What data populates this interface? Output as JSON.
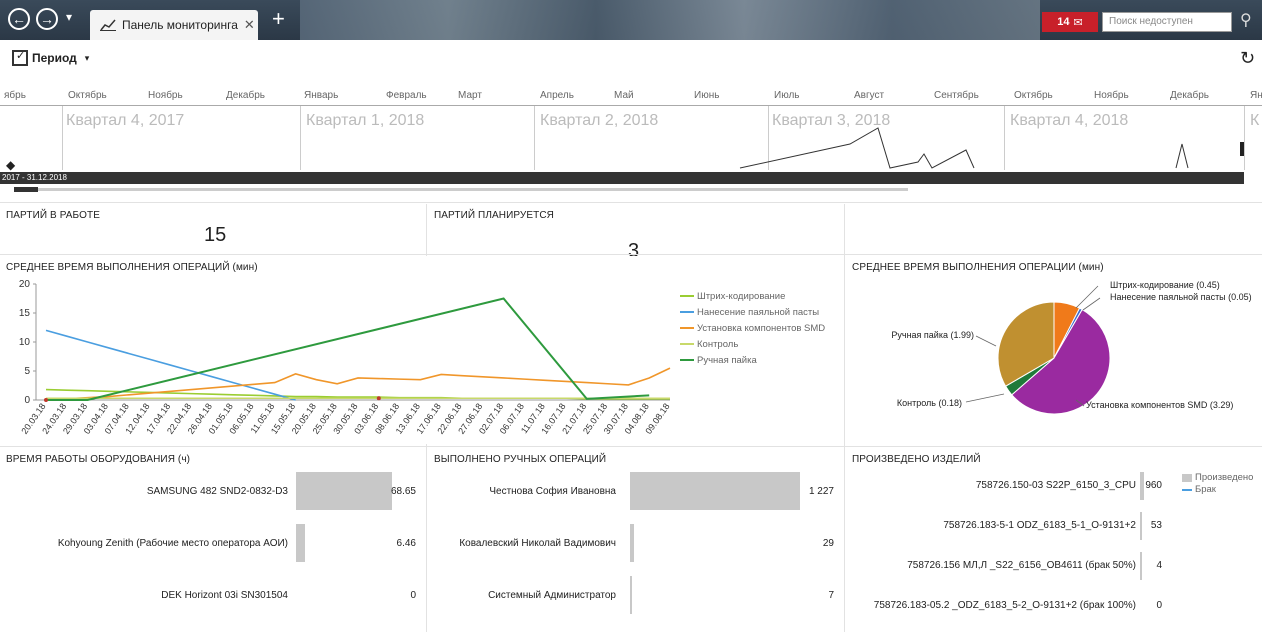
{
  "titlebar": {
    "back": "←",
    "forward": "→",
    "dropdown": "▾",
    "tab_label": "Панель мониторинга",
    "tab_close": "✕",
    "new_tab": "+",
    "notif_count": "14",
    "search_placeholder": "Поиск недоступен"
  },
  "toolbar": {
    "period_label": "Период"
  },
  "timeline": {
    "months": [
      "ябрь",
      "Октябрь",
      "Ноябрь",
      "Декабрь",
      "Январь",
      "Февраль",
      "Март",
      "Апрель",
      "Май",
      "Июнь",
      "Июль",
      "Август",
      "Сентябрь",
      "Октябрь",
      "Ноябрь",
      "Декабрь",
      "Ян"
    ],
    "quarters": [
      "Квартал 4, 2017",
      "Квартал 1, 2018",
      "Квартал 2, 2018",
      "Квартал 3, 2018",
      "Квартал 4, 2018",
      "К"
    ],
    "range_label": "2017 - 31.12.2018"
  },
  "kpi": {
    "in_work_title": "ПАРТИЙ В РАБОТЕ",
    "in_work_value": "15",
    "planned_title": "ПАРТИЙ ПЛАНИРУЕТСЯ",
    "planned_value": "3"
  },
  "line_chart_title": "СРЕДНЕЕ ВРЕМЯ ВЫПОЛНЕНИЯ ОПЕРАЦИЙ (мин)",
  "pie_chart_title": "СРЕДНЕЕ ВРЕМЯ ВЫПОЛНЕНИЯ ОПЕРАЦИИ (мин)",
  "equipment_title": "ВРЕМЯ РАБОТЫ ОБОРУДОВАНИЯ (ч)",
  "manual_title": "ВЫПОЛНЕНО РУЧНЫХ ОПЕРАЦИЙ",
  "produced_title": "ПРОИЗВЕДЕНО ИЗДЕЛИЙ",
  "colors": {
    "barcode": "#9acd32",
    "paste": "#4a9ee0",
    "smd": "#f0962a",
    "control": "#c8d96a",
    "manual": "#2e9a3e",
    "pie_manual": "#c09030",
    "pie_smd": "#9a2aa0",
    "pie_control": "#1f7a3a",
    "pie_barcode": "#f07a1a",
    "pie_paste": "#3a6ad0"
  },
  "chart_data": [
    {
      "type": "line",
      "ylim": [
        0,
        20
      ],
      "yticks": [
        0,
        5,
        10,
        15,
        20
      ],
      "x": [
        "20.03.18",
        "24.03.18",
        "29.03.18",
        "03.04.18",
        "07.04.18",
        "12.04.18",
        "17.04.18",
        "22.04.18",
        "26.04.18",
        "01.05.18",
        "06.05.18",
        "11.05.18",
        "15.05.18",
        "20.05.18",
        "25.05.18",
        "30.05.18",
        "03.06.18",
        "08.06.18",
        "13.06.18",
        "17.06.18",
        "22.06.18",
        "27.06.18",
        "02.07.18",
        "06.07.18",
        "11.07.18",
        "16.07.18",
        "21.07.18",
        "25.07.18",
        "30.07.18",
        "04.08.18",
        "09.08.18"
      ],
      "series": [
        {
          "name": "Штрих-кодирование",
          "values": [
            1.8,
            1.7,
            1.6,
            1.5,
            1.4,
            1.3,
            1.2,
            1.1,
            1.0,
            0.9,
            0.8,
            0.7,
            0.6,
            0.6,
            0.5,
            0.5,
            0.5,
            0.4,
            0.4,
            0.4,
            0.3,
            0.3,
            0.3,
            0.3,
            0.3,
            0.3,
            0.2,
            0.2,
            0.2,
            0.2,
            0.2
          ]
        },
        {
          "name": "Нанесение паяльной пасты",
          "values": [
            12,
            11,
            10,
            9,
            8,
            7,
            6,
            5,
            4,
            3,
            2,
            1,
            0,
            null,
            null,
            null,
            null,
            null,
            null,
            null,
            null,
            null,
            null,
            null,
            null,
            null,
            null,
            null,
            null,
            null,
            null
          ]
        },
        {
          "name": "Установка компонентов SMD",
          "values": [
            0,
            0.2,
            0.4,
            0.6,
            0.9,
            1.2,
            1.5,
            1.8,
            2.1,
            2.4,
            2.7,
            3.0,
            4.5,
            3.5,
            2.8,
            3.8,
            3.7,
            3.6,
            3.5,
            4.4,
            4.2,
            4.0,
            3.8,
            3.6,
            3.4,
            3.2,
            3.0,
            2.8,
            2.6,
            3.8,
            5.5
          ]
        },
        {
          "name": "Контроль",
          "values": [
            0.3,
            0.3,
            0.3,
            0.3,
            0.3,
            0.3,
            0.3,
            0.3,
            0.3,
            0.3,
            0.3,
            0.3,
            0.3,
            0.3,
            0.3,
            0.3,
            0.3,
            0.3,
            0.3,
            0.3,
            0.3,
            0.3,
            0.3,
            0.3,
            0.3,
            0.3,
            0.3,
            0.3,
            0.3,
            0.3,
            0.3
          ]
        },
        {
          "name": "Ручная пайка",
          "values": [
            0,
            0,
            0,
            null,
            null,
            null,
            null,
            null,
            null,
            null,
            null,
            null,
            null,
            null,
            null,
            null,
            null,
            null,
            null,
            null,
            null,
            null,
            17.5,
            null,
            null,
            null,
            0.2,
            null,
            null,
            0.8,
            null
          ]
        }
      ]
    },
    {
      "type": "pie",
      "slices": [
        {
          "label": "Штрих-кодирование (0.45)",
          "value": 0.45
        },
        {
          "label": "Нанесение паяльной пасты (0.05)",
          "value": 0.05
        },
        {
          "label": "Установка компонентов SMD (3.29)",
          "value": 3.29
        },
        {
          "label": "Контроль (0.18)",
          "value": 0.18
        },
        {
          "label": "Ручная пайка (1.99)",
          "value": 1.99
        }
      ]
    },
    {
      "type": "bar",
      "categories": [
        "SAMSUNG 482 SND2-0832-D3",
        "Kohyoung Zenith (Рабочие место оператора АОИ)",
        "DEK Horizont 03i SN301504"
      ],
      "values": [
        68.65,
        6.46,
        0
      ],
      "labels": [
        "68.65",
        "6.46",
        "0"
      ]
    },
    {
      "type": "bar",
      "categories": [
        "Честнова София Ивановна",
        "Ковалевский Николай Вадимович",
        "Системный Администратор"
      ],
      "values": [
        1227,
        29,
        7
      ],
      "labels": [
        "1 227",
        "29",
        "7"
      ]
    },
    {
      "type": "bar",
      "categories": [
        "758726.150-03 S22P_6150_3_CPU",
        "758726.183-5-1 ODZ_6183_5-1_O-9131+2",
        "758726.156 МЛ,Л _S22_6156_OB4611 (брак 50%)",
        "758726.183-05.2 _ODZ_6183_5-2_O-9131+2 (брак 100%)"
      ],
      "values": [
        960,
        53,
        4,
        0
      ],
      "labels": [
        "960",
        "53",
        "4",
        "0"
      ],
      "legend": [
        "Произведено",
        "Брак"
      ]
    }
  ]
}
